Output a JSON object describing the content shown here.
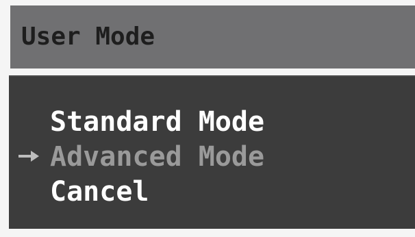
{
  "dialog": {
    "title": "User Mode"
  },
  "menu": {
    "items": [
      {
        "label": "Standard Mode",
        "selected": false
      },
      {
        "label": "Advanced Mode",
        "selected": true
      },
      {
        "label": "Cancel",
        "selected": false
      }
    ],
    "selector_icon": "arrow-right-icon"
  },
  "colors": {
    "title_bar": "#707072",
    "title_text": "#1e1e1e",
    "panel_background": "#3c3c3c",
    "item_text": "#ffffff",
    "selected_text": "#9a9a9a",
    "page_background": "#f5f5f5"
  }
}
